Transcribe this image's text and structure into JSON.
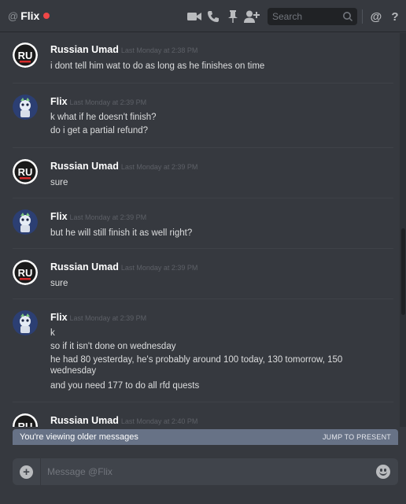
{
  "header": {
    "at_symbol": "@",
    "channel_name": "Flix",
    "search_placeholder": "Search",
    "mention_symbol": "@",
    "help_symbol": "?"
  },
  "avatars": {
    "russian_text": "RU"
  },
  "messages": [
    {
      "author": "Russian Umad",
      "avatar": "russian",
      "timestamp": "Last Monday at 2:38 PM",
      "lines": [
        "i dont tell him wat to do as long as he finishes on time"
      ]
    },
    {
      "author": "Flix",
      "avatar": "flix",
      "timestamp": "Last Monday at 2:39 PM",
      "lines": [
        "k what if he doesn't finish?",
        "do i get a partial refund?"
      ]
    },
    {
      "author": "Russian Umad",
      "avatar": "russian",
      "timestamp": "Last Monday at 2:39 PM",
      "lines": [
        "sure"
      ]
    },
    {
      "author": "Flix",
      "avatar": "flix",
      "timestamp": "Last Monday at 2:39 PM",
      "lines": [
        "but he will still finish it as well right?"
      ]
    },
    {
      "author": "Russian Umad",
      "avatar": "russian",
      "timestamp": "Last Monday at 2:39 PM",
      "lines": [
        "sure"
      ]
    },
    {
      "author": "Flix",
      "avatar": "flix",
      "timestamp": "Last Monday at 2:39 PM",
      "lines": [
        "k",
        "so if it isn't done on wednesday",
        "he had 80 yesterday, he's probably around 100 today, 130 tomorrow, 150 wednesday",
        "and you need 177 to do all rfd quests"
      ]
    },
    {
      "author": "Russian Umad",
      "avatar": "russian",
      "timestamp": "Last Monday at 2:40 PM",
      "lines": []
    }
  ],
  "older_bar": {
    "text": "You're viewing older messages",
    "jump": "JUMP TO PRESENT"
  },
  "composer": {
    "placeholder": "Message @Flix"
  },
  "colors": {
    "background": "#36393f",
    "unread_dot": "#f04747",
    "older_bar": "#677286",
    "composer": "#40444b"
  }
}
